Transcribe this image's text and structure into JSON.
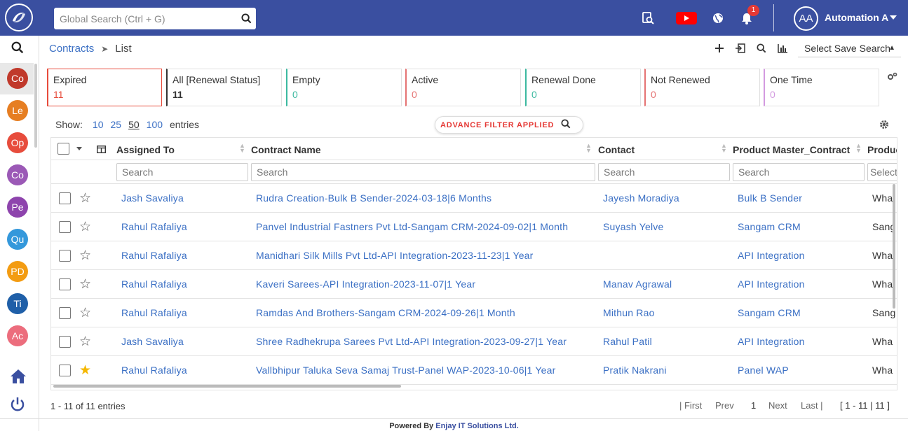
{
  "topbar": {
    "search_placeholder": "Global Search (Ctrl + G)",
    "notification_count": "1",
    "user_initials": "AA",
    "user_name": "Automation A",
    "brand_color": "#3a4fa0"
  },
  "sidebar": {
    "items": [
      {
        "label": "Co",
        "color": "#c0392b"
      },
      {
        "label": "Le",
        "color": "#e67e22"
      },
      {
        "label": "Op",
        "color": "#e74c3c"
      },
      {
        "label": "Co",
        "color": "#9b59b6"
      },
      {
        "label": "Pe",
        "color": "#8e44ad"
      },
      {
        "label": "Qu",
        "color": "#3498db"
      },
      {
        "label": "PD",
        "color": "#f39c12"
      },
      {
        "label": "Ti",
        "color": "#1f5fa8"
      },
      {
        "label": "Ac",
        "color": "#ec6d7d"
      }
    ]
  },
  "breadcrumb": {
    "module": "Contracts",
    "page": "List"
  },
  "save_search_label": "Select Save Search",
  "status_cards": [
    {
      "label": "Expired",
      "count": "11",
      "border": "#e74c3c",
      "count_color": "#e74c3c"
    },
    {
      "label": "All [Renewal Status]",
      "count": "11",
      "border": "#333333",
      "count_color": "#333333"
    },
    {
      "label": "Empty",
      "count": "0",
      "border": "#3cb9a0",
      "count_color": "#3cb9a0"
    },
    {
      "label": "Active",
      "count": "0",
      "border": "#e57373",
      "count_color": "#e57373"
    },
    {
      "label": "Renewal Done",
      "count": "0",
      "border": "#3cb9a0",
      "count_color": "#3cb9a0"
    },
    {
      "label": "Not Renewed",
      "count": "0",
      "border": "#e57373",
      "count_color": "#e57373"
    },
    {
      "label": "One Time",
      "count": "0",
      "border": "#d39ae0",
      "count_color": "#d39ae0"
    }
  ],
  "show_entries": {
    "label": "Show:",
    "options": [
      "10",
      "25",
      "50",
      "100"
    ],
    "selected": "50",
    "suffix": "entries"
  },
  "advance_filter_label": "ADVANCE FILTER APPLIED",
  "table": {
    "columns": [
      "Assigned To",
      "Contract Name",
      "Contact",
      "Product Master_Contract",
      "Produc"
    ],
    "filter_placeholders": [
      "Search",
      "Search",
      "Search",
      "Search",
      "Select"
    ],
    "rows": [
      {
        "assigned": "Jash Savaliya",
        "contract": "Rudra Creation-Bulk B Sender-2024-03-18|6 Months",
        "contact": "Jayesh Moradiya",
        "product": "Bulk B Sender",
        "extra": "Wha",
        "starred": false
      },
      {
        "assigned": "Rahul Rafaliya",
        "contract": "Panvel Industrial Fastners Pvt Ltd-Sangam CRM-2024-09-02|1 Month",
        "contact": "Suyash Yelve",
        "product": "Sangam CRM",
        "extra": "Sang",
        "starred": false
      },
      {
        "assigned": "Rahul Rafaliya",
        "contract": "Manidhari Silk Mills Pvt Ltd-API Integration-2023-11-23|1 Year",
        "contact": "",
        "product": "API Integration",
        "extra": "Wha",
        "starred": false
      },
      {
        "assigned": "Rahul Rafaliya",
        "contract": "Kaveri Sarees-API Integration-2023-11-07|1 Year",
        "contact": "Manav Agrawal",
        "product": "API Integration",
        "extra": "Wha",
        "starred": false
      },
      {
        "assigned": "Rahul Rafaliya",
        "contract": "Ramdas And Brothers-Sangam CRM-2024-09-26|1 Month",
        "contact": "Mithun Rao",
        "product": "Sangam CRM",
        "extra": "Sang",
        "starred": false
      },
      {
        "assigned": "Jash Savaliya",
        "contract": "Shree Radhekrupa Sarees Pvt Ltd-API Integration-2023-09-27|1 Year",
        "contact": "Rahul Patil",
        "product": "API Integration",
        "extra": "Wha",
        "starred": false
      },
      {
        "assigned": "Rahul Rafaliya",
        "contract": "Vallbhipur Taluka Seva Samaj Trust-Panel WAP-2023-10-06|1 Year",
        "contact": "Pratik Nakrani",
        "product": "Panel WAP",
        "extra": "Wha",
        "starred": true
      }
    ]
  },
  "footer": {
    "info": "1 - 11 of 11 entries",
    "first": "| First",
    "prev": "Prev",
    "page": "1",
    "next": "Next",
    "last": "Last |",
    "range": "[ 1 - 11 | 11 ]"
  },
  "powered": {
    "prefix": "Powered By",
    "company": "Enjay IT Solutions Ltd."
  }
}
